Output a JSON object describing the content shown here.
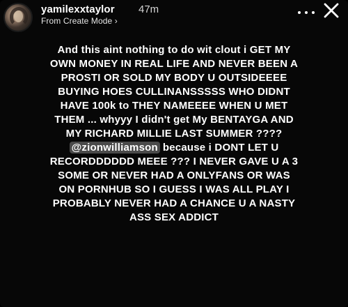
{
  "header": {
    "username": "yamilexxtaylor",
    "time": "47m",
    "mode_label": "From Create Mode",
    "mode_chevron": "›"
  },
  "icons": {
    "menu": "more-options-icon",
    "close": "close-icon"
  },
  "story": {
    "lines": [
      "And this aint nothing to do wit clout i GET MY",
      "OWN MONEY IN REAL LIFE AND NEVER BEEN A",
      "PROSTI OR SOLD MY BODY U OUTSIDEEEE",
      "BUYING HOES CULLINANSSSSS WHO DIDNT",
      "HAVE 100k to  THEY NAMEEEE WHEN U MET",
      "THEM  ... whyyy I didn't get  My BENTAYGA AND",
      "MY RICHARD MILLIE LAST SUMMER ????"
    ],
    "mention": "@zionwilliamson",
    "mention_tail": "because i DONT LET U",
    "lines_after": [
      "RECORDDDDDD MEEE ??? I  NEVER GAVE U A 3",
      "SOME OR NEVER HAD A  ONLYFANS OR WAS",
      "ON PORNHUB SO I GUESS I WAS  ALL PLAY  I",
      "PROBABLY NEVER HAD A CHANCE U A NASTY",
      "ASS SEX ADDICT"
    ]
  },
  "colors": {
    "background": "#000000",
    "text": "#ffffff",
    "mention_bg": "#4a4a4a"
  }
}
